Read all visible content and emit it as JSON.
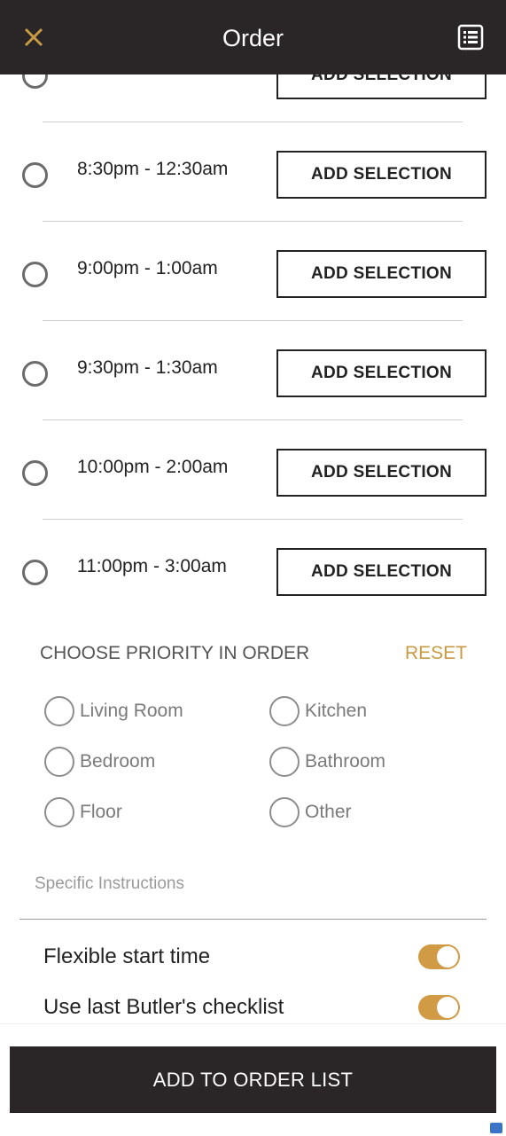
{
  "header": {
    "title": "Order",
    "close_icon": "close-icon",
    "list_icon": "list-icon",
    "accent_color": "#c99a44"
  },
  "time_slots": [
    {
      "time": "",
      "button": "ADD SELECTION"
    },
    {
      "time": "8:30pm - 12:30am",
      "button": "ADD SELECTION"
    },
    {
      "time": "9:00pm - 1:00am",
      "button": "ADD SELECTION"
    },
    {
      "time": "9:30pm - 1:30am",
      "button": "ADD SELECTION"
    },
    {
      "time": "10:00pm - 2:00am",
      "button": "ADD SELECTION"
    },
    {
      "time": "11:00pm - 3:00am",
      "button": "ADD SELECTION"
    }
  ],
  "priority": {
    "heading": "CHOOSE PRIORITY IN ORDER",
    "reset": "RESET",
    "options": [
      "Living Room",
      "Kitchen",
      "Bedroom",
      "Bathroom",
      "Floor",
      "Other"
    ]
  },
  "instructions": {
    "placeholder": "Specific Instructions"
  },
  "toggles": [
    {
      "label": "Flexible start time",
      "on": true
    },
    {
      "label": "Use last Butler's checklist",
      "on": true
    }
  ],
  "footer": {
    "button": "ADD TO ORDER LIST"
  }
}
